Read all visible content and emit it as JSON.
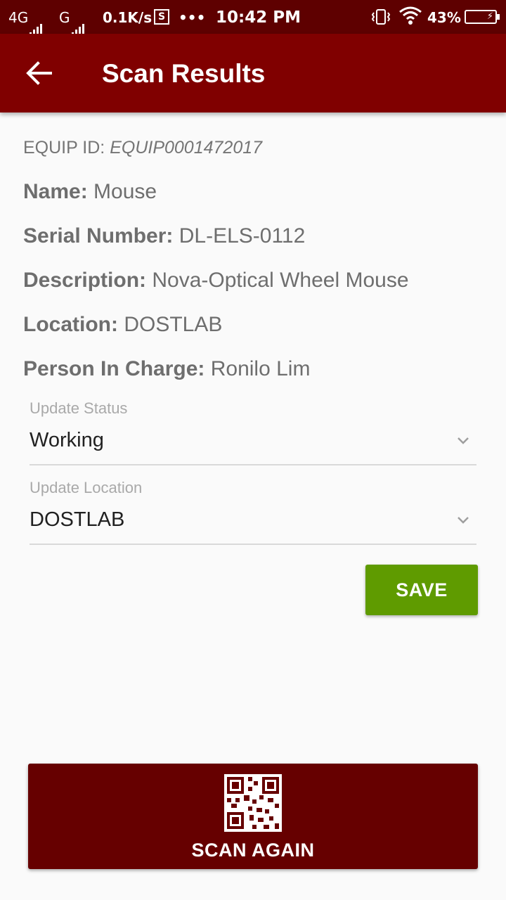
{
  "status_bar": {
    "network_1": "4G",
    "network_2": "G",
    "speed": "0.1K/s",
    "s_badge": "S",
    "more": "•••",
    "time": "10:42 PM",
    "battery_pct": "43%",
    "battery_icon": "⚡"
  },
  "app_bar": {
    "title": "Scan Results",
    "back_icon": "arrow-left-icon"
  },
  "equipment": {
    "equip_id_label": "EQUIP ID:",
    "equip_id": "EQUIP0001472017",
    "name_label": "Name:",
    "name": "Mouse",
    "serial_label": "Serial Number:",
    "serial": "DL-ELS-0112",
    "description_label": "Description:",
    "description": "Nova-Optical Wheel Mouse",
    "location_label": "Location:",
    "location": "DOSTLAB",
    "person_label": "Person In Charge:",
    "person": "Ronilo Lim"
  },
  "form": {
    "status_label": "Update Status",
    "status_value": "Working",
    "location_label": "Update Location",
    "location_value": "DOSTLAB",
    "save_label": "SAVE"
  },
  "scan": {
    "label": "SCAN AGAIN",
    "icon": "qr-code-icon"
  },
  "colors": {
    "status_bar": "#5e0000",
    "app_bar": "#800000",
    "save_button": "#5f9b00",
    "scan_button": "#660000",
    "background": "#fafafa"
  }
}
